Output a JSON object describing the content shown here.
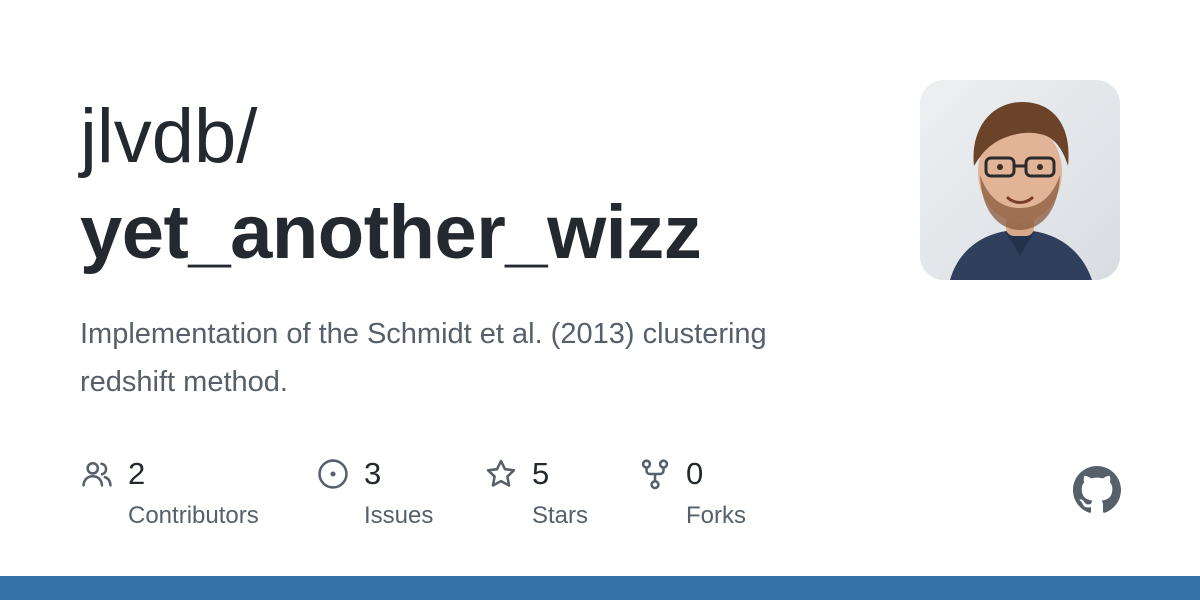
{
  "repo": {
    "owner": "jlvdb/",
    "name": "yet_another_wizz",
    "description": "Implementation of the Schmidt et al. (2013) clustering redshift method."
  },
  "avatar": {
    "icon": "user-avatar-photo"
  },
  "stats": [
    {
      "icon": "people-icon",
      "count": "2",
      "label": "Contributors"
    },
    {
      "icon": "issue-opened-icon",
      "count": "3",
      "label": "Issues"
    },
    {
      "icon": "star-icon",
      "count": "5",
      "label": "Stars"
    },
    {
      "icon": "repo-forked-icon",
      "count": "0",
      "label": "Forks"
    }
  ],
  "logo": {
    "icon": "github-mark-icon"
  },
  "colors": {
    "text_primary": "#24292f",
    "text_secondary": "#57606a",
    "icon": "#57606a",
    "bottom_bar": "#3572a5",
    "logo": "#57606a"
  }
}
